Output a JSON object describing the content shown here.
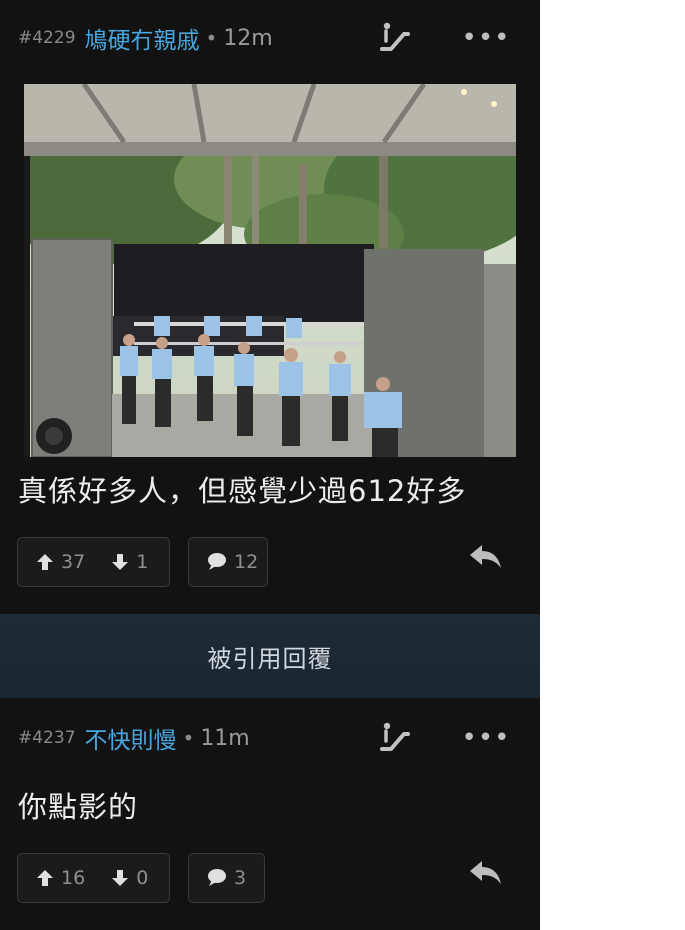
{
  "posts": [
    {
      "number": "#4229",
      "author": "鳩硬冇親戚",
      "time": "12m",
      "text": "真係好多人，但感覺少過612好多",
      "upvotes": "37",
      "downvotes": "1",
      "comments": "12",
      "image": "photo of police officers in light blue shirts behind metal barriers with a crowd dressed in black beyond, viewed from under a building canopy"
    },
    {
      "number": "#4237",
      "author": "不快則慢",
      "time": "11m",
      "text": "你點影的",
      "upvotes": "16",
      "downvotes": "0",
      "comments": "3"
    }
  ],
  "quote_bar": {
    "label": "被引用回覆"
  },
  "colors": {
    "background": "#121212",
    "author": "#48a6e0",
    "quote_bar": "#1e2b35"
  },
  "icons": [
    "escalator-icon",
    "more-icon",
    "upvote-icon",
    "downvote-icon",
    "comment-icon",
    "reply-icon"
  ]
}
